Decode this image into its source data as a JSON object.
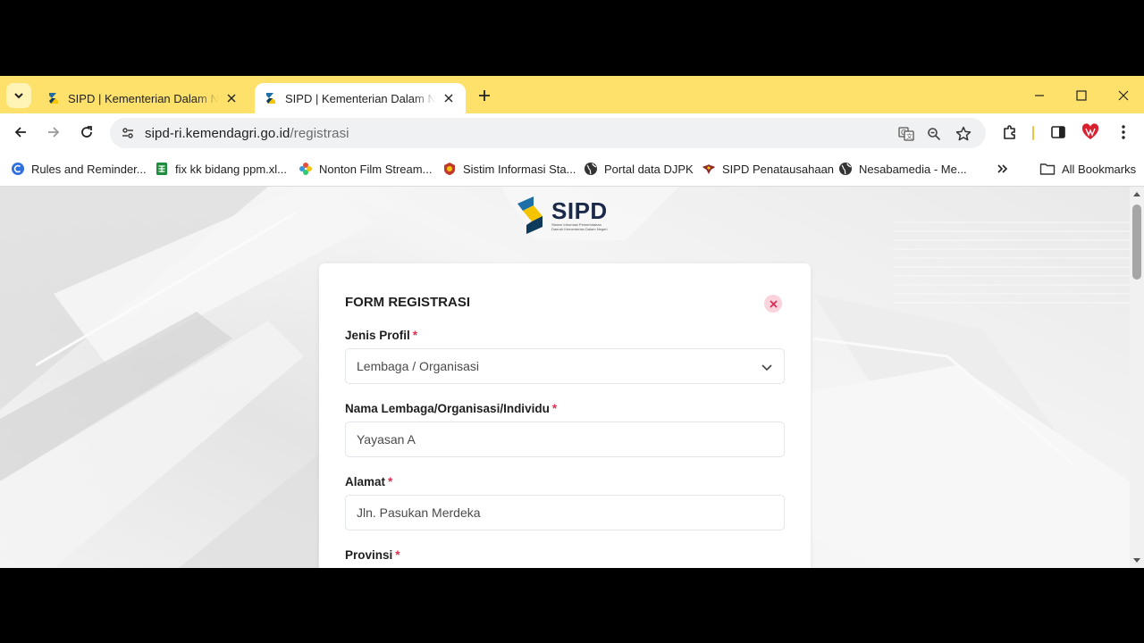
{
  "tabs": [
    {
      "title": "SIPD | Kementerian Dalam Negeri",
      "active": false
    },
    {
      "title": "SIPD | Kementerian Dalam Negeri",
      "active": true
    }
  ],
  "toolbar": {
    "url_host": "sipd-ri.kemendagri.go.id",
    "url_path": "/registrasi"
  },
  "bookmarks": [
    {
      "label": "Rules and Reminder...",
      "icon": "blue-circle-icon"
    },
    {
      "label": "fix kk bidang ppm.xl...",
      "icon": "sheets-icon"
    },
    {
      "label": "Nonton Film Stream...",
      "icon": "flower-icon"
    },
    {
      "label": "Sistim Informasi Sta...",
      "icon": "emblem-icon"
    },
    {
      "label": "Portal data DJPK",
      "icon": "globe-icon"
    },
    {
      "label": "SIPD Penatausahaan",
      "icon": "eagle-icon"
    },
    {
      "label": "Nesabamedia - Me...",
      "icon": "globe-icon"
    }
  ],
  "all_bookmarks": "All Bookmarks",
  "logo": {
    "brand": "SIPD",
    "tagline": "Sistem Informasi Pemerintahan Daerah Kementerian Dalam Negeri"
  },
  "form": {
    "title": "FORM REGISTRASI",
    "required_mark": "*",
    "fields": [
      {
        "label": "Jenis Profil",
        "value": "Lembaga / Organisasi",
        "type": "select"
      },
      {
        "label": "Nama Lembaga/Organisasi/Individu",
        "value": "Yayasan A",
        "type": "text"
      },
      {
        "label": "Alamat",
        "value": "Jln. Pasukan Merdeka",
        "type": "text"
      },
      {
        "label": "Provinsi",
        "value": "",
        "type": "select"
      }
    ]
  },
  "colors": {
    "tabstrip": "#fde16a",
    "required": "#e0304f",
    "logo_blue": "#1b2a4a",
    "logo_yellow": "#f5c400"
  }
}
